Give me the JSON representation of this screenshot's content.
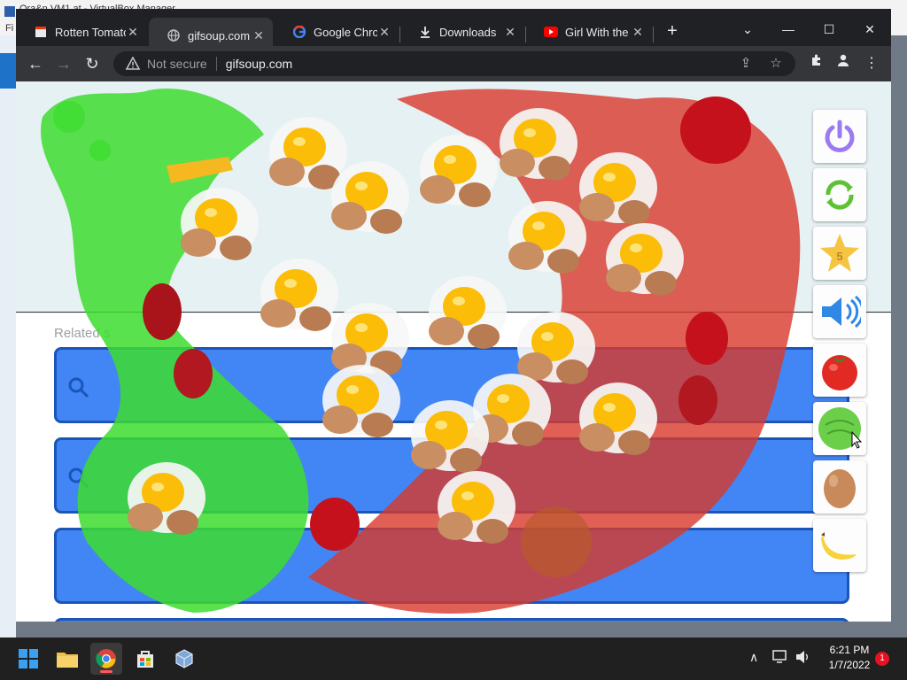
{
  "background_window": {
    "title": "Ora&n VM1  at  - VirtualBox Manager",
    "menu": "Fi"
  },
  "tabs": [
    {
      "label": "Rotten Tomatoes",
      "icon": "clapperboard-icon"
    },
    {
      "label": "gifsoup.com",
      "icon": "globe-icon",
      "active": true
    },
    {
      "label": "Google Chrome",
      "icon": "google-icon"
    },
    {
      "label": "Downloads",
      "icon": "download-icon"
    },
    {
      "label": "Girl With the ni",
      "icon": "youtube-icon"
    }
  ],
  "omnibox": {
    "security": "Not secure",
    "url": "gifsoup.com"
  },
  "page": {
    "related_label": "Related s"
  },
  "palette": {
    "items": [
      "power-icon",
      "refresh-icon",
      "star-icon",
      "speaker-icon",
      "tomato-icon",
      "cabbage-icon",
      "egg-icon",
      "banana-icon"
    ],
    "star_value": "5"
  },
  "taskbar": {
    "time": "6:21 PM",
    "date": "1/7/2022",
    "notification_count": "1"
  },
  "colors": {
    "chrome_dark": "#202124",
    "search_blue": "#4285f4",
    "splash_green": "#3ddc2f",
    "splash_red": "#d8382a",
    "egg_yolk": "#fbbd08"
  }
}
